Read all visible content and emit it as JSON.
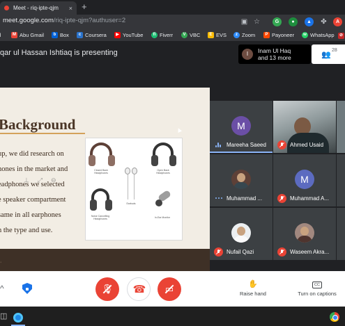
{
  "browser": {
    "tab_title": "Meet - riq-ipte-qjm",
    "tab_close": "×",
    "new_tab": "+",
    "url_domain": "meet.google.com",
    "url_path": "/riq-ipte-qjm?authuser=2"
  },
  "bookmarks": [
    {
      "label": "il",
      "icon": "bookmark-icon",
      "color": "#fbbc04"
    },
    {
      "label": "Abu Gmail",
      "icon": "gmail-icon",
      "color": "#ea4335"
    },
    {
      "label": "Box",
      "icon": "box-icon",
      "color": "#0061d5"
    },
    {
      "label": "Coursera",
      "icon": "coursera-icon",
      "color": "#2a73cc"
    },
    {
      "label": "YouTube",
      "icon": "youtube-icon",
      "color": "#ff0000"
    },
    {
      "label": "Fiverr",
      "icon": "fiverr-icon",
      "color": "#1dbf73"
    },
    {
      "label": "VBC",
      "icon": "vbc-icon",
      "color": "#34a853"
    },
    {
      "label": "EVS",
      "icon": "evs-icon",
      "color": "#fbbc04"
    },
    {
      "label": "Zoom",
      "icon": "zoom-icon",
      "color": "#2d8cff"
    },
    {
      "label": "Payoneer",
      "icon": "payoneer-icon",
      "color": "#ff4800"
    },
    {
      "label": "WhatsApp",
      "icon": "whatsapp-icon",
      "color": "#25d366"
    }
  ],
  "meet": {
    "presenting_text": "qar ul Hassan Ishtiaq is presenting",
    "presenter_pill": {
      "initial": "I",
      "line1": "Inam Ul Haq",
      "line2": "and 13 more"
    },
    "people_count": "28"
  },
  "slide": {
    "title": "Background",
    "lines": [
      "up, we did research on",
      "hones in the market and",
      "eadphones we selected",
      "e speaker compartment",
      "same in all earphones",
      "n the type and use."
    ],
    "image_labels": [
      "Closed Back Headphones",
      "Open Back Headphones",
      "Earbuds",
      "Noise Cancelling Headphones",
      "In-Ear Monitor"
    ]
  },
  "participants": [
    {
      "name": "Mareeha Saeed",
      "kind": "avatar",
      "initial": "M",
      "color": "#6b4fa6",
      "status": "speaking"
    },
    {
      "name": "Ahmed Usaid",
      "kind": "camera",
      "status": "muted"
    },
    {
      "name": "Muhammad ...",
      "kind": "photo",
      "status": "dots"
    },
    {
      "name": "Muhammad A...",
      "kind": "avatar",
      "initial": "M",
      "color": "#5c6bc0",
      "status": "muted"
    },
    {
      "name": "Nufail Qazi",
      "kind": "photo",
      "status": "muted"
    },
    {
      "name": "Waseem Akra...",
      "kind": "photo",
      "status": "muted"
    }
  ],
  "controls": {
    "raise_hand": "Raise hand",
    "captions": "Turn on captions",
    "captions_badge": "CC"
  }
}
